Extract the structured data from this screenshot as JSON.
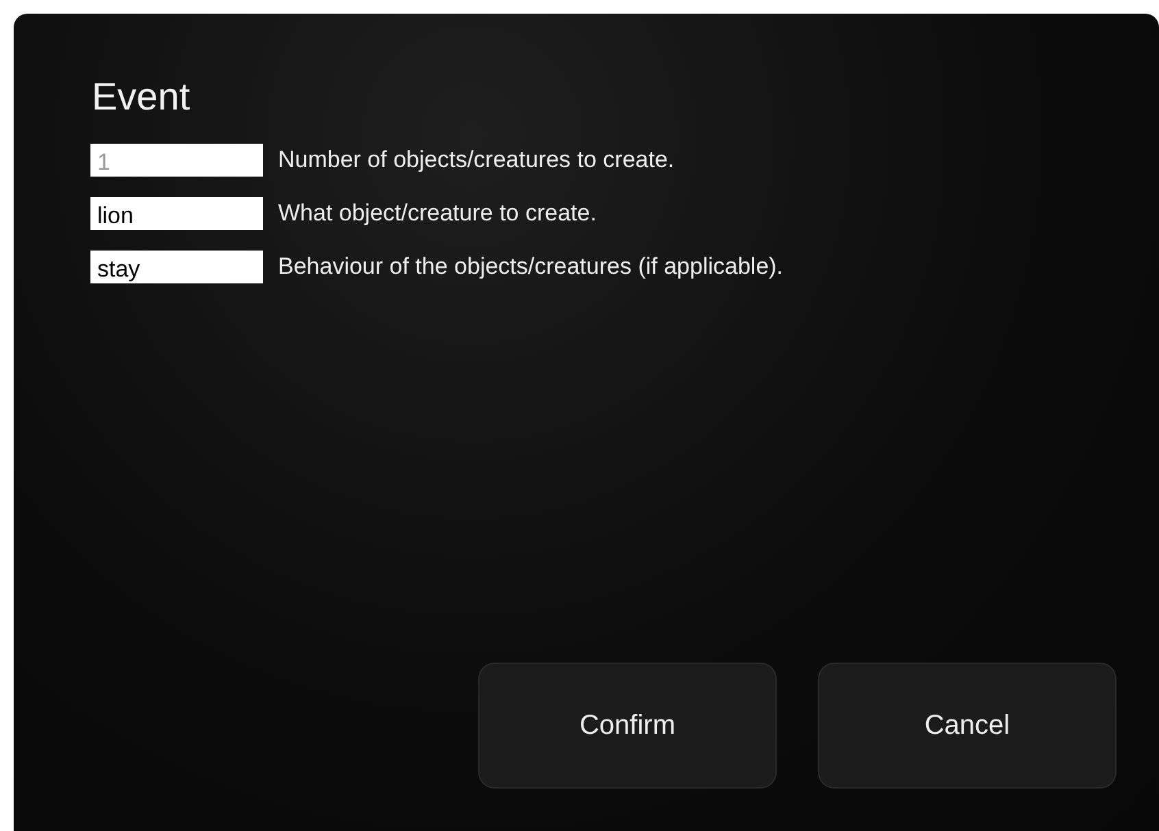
{
  "dialog": {
    "title": "Event"
  },
  "fields": [
    {
      "placeholder": "1",
      "label": "Number of objects/creatures to create."
    },
    {
      "value": "lion",
      "label": "What object/creature to create."
    },
    {
      "value": "stay",
      "label": "Behaviour of the objects/creatures (if applicable)."
    }
  ],
  "buttons": [
    "Confirm",
    "Cancel"
  ]
}
